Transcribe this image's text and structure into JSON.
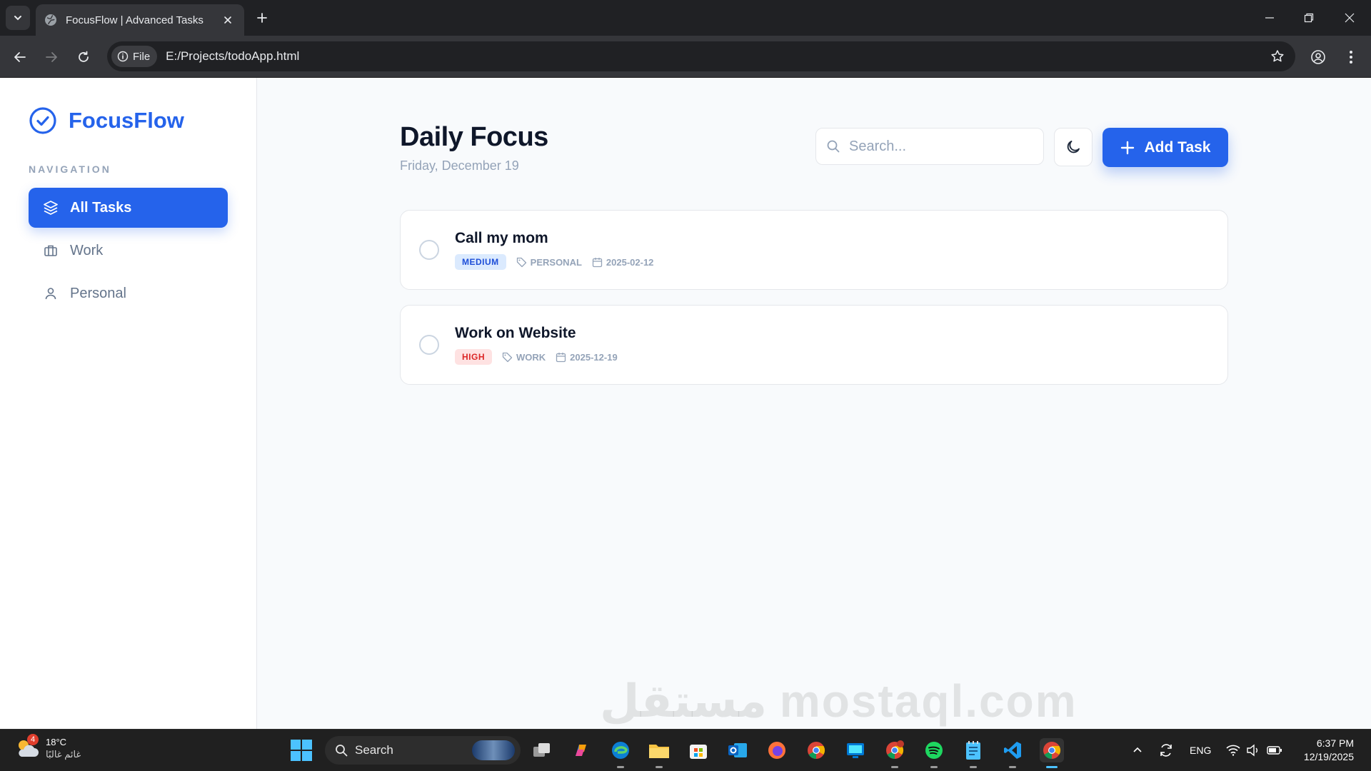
{
  "browser": {
    "tab_title": "FocusFlow | Advanced Tasks",
    "url_scheme_label": "File",
    "url": "E:/Projects/todoApp.html"
  },
  "app": {
    "brand": "FocusFlow",
    "nav_heading": "NAVIGATION",
    "nav_items": [
      {
        "label": "All Tasks",
        "icon": "layers-icon",
        "active": true
      },
      {
        "label": "Work",
        "icon": "briefcase-icon",
        "active": false
      },
      {
        "label": "Personal",
        "icon": "user-icon",
        "active": false
      }
    ],
    "page_title": "Daily Focus",
    "page_date": "Friday, December 19",
    "search_placeholder": "Search...",
    "add_task_label": "Add Task",
    "tasks": [
      {
        "title": "Call my mom",
        "priority": "MEDIUM",
        "category": "PERSONAL",
        "date": "2025-02-12",
        "completed": false
      },
      {
        "title": "Work on Website",
        "priority": "HIGH",
        "category": "WORK",
        "date": "2025-12-19",
        "completed": false
      }
    ],
    "colors": {
      "accent": "#2563eb",
      "medium": "#1d4ed8",
      "high": "#dc2626"
    }
  },
  "taskbar": {
    "weather_temp": "18°C",
    "weather_desc": "غائم غالبًا",
    "weather_badge": "4",
    "search_label": "Search",
    "language": "ENG",
    "time": "6:37 PM",
    "date": "12/19/2025",
    "watermark": "مستقل mostaql.com"
  }
}
